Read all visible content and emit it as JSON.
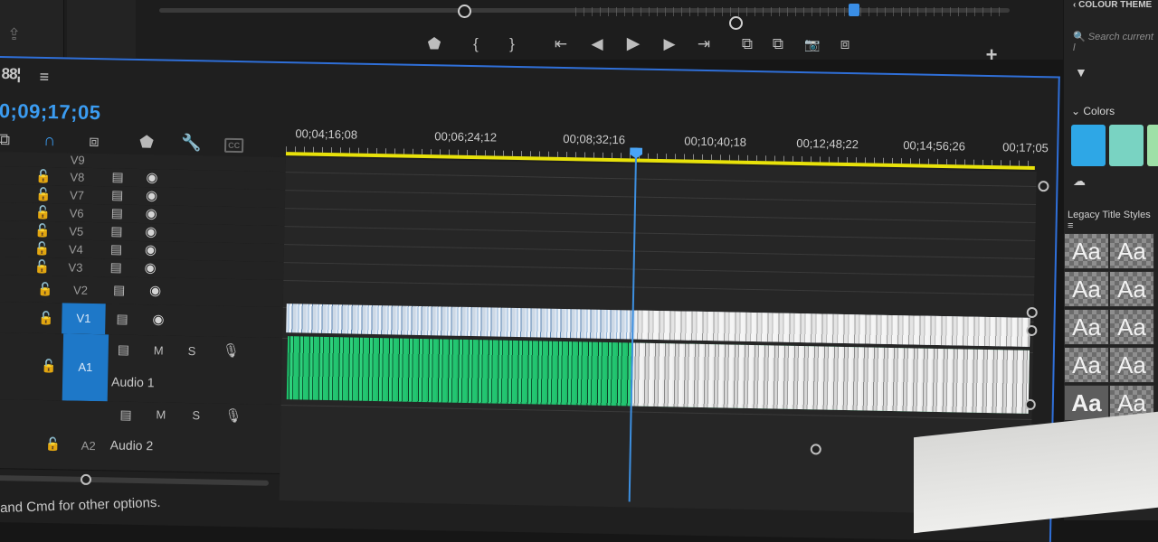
{
  "program_monitor": {
    "transport_buttons": [
      {
        "id": "marker",
        "glyph": "⬟"
      },
      {
        "id": "mark-in",
        "glyph": "{"
      },
      {
        "id": "mark-out",
        "glyph": "}"
      },
      {
        "id": "go-to-in",
        "glyph": "⇤"
      },
      {
        "id": "step-back",
        "glyph": "◀"
      },
      {
        "id": "play",
        "glyph": "▶"
      },
      {
        "id": "step-forward",
        "glyph": "▶"
      },
      {
        "id": "go-to-out",
        "glyph": "⇥"
      },
      {
        "id": "lift",
        "glyph": "⧉"
      },
      {
        "id": "extract",
        "glyph": "⧉"
      },
      {
        "id": "export-frame",
        "glyph": "📷"
      },
      {
        "id": "compare",
        "glyph": "⧈"
      }
    ],
    "add_glyph": "+"
  },
  "timeline": {
    "menu_glyph": "≡",
    "seq_glyph": "88¦",
    "timecode": "0;09;17;05",
    "ruler_labels": [
      "00;04;16;08",
      "00;06;24;12",
      "00;08;32;16",
      "00;10;40;18",
      "00;12;48;22",
      "00;14;56;26",
      "00;17;05"
    ],
    "video_tracks": [
      "V9",
      "V8",
      "V7",
      "V6",
      "V5",
      "V4",
      "V3",
      "V2",
      "V1"
    ],
    "audio_tracks": [
      {
        "target": "A1",
        "name": "Audio 1"
      },
      {
        "target": "A2",
        "name": "Audio 2"
      }
    ],
    "mute_label": "M",
    "solo_label": "S"
  },
  "status_bar": {
    "text": "and Cmd for other options."
  },
  "right_panel": {
    "colour_theme": "COLOUR THEME",
    "search_placeholder": "Search current l",
    "colors_title": "Colors",
    "swatches": [
      "#2ea7e6",
      "#79d3c2",
      "#9fe0a7"
    ],
    "legacy_title": "Legacy Title Styles",
    "style_sample": "Aa"
  }
}
